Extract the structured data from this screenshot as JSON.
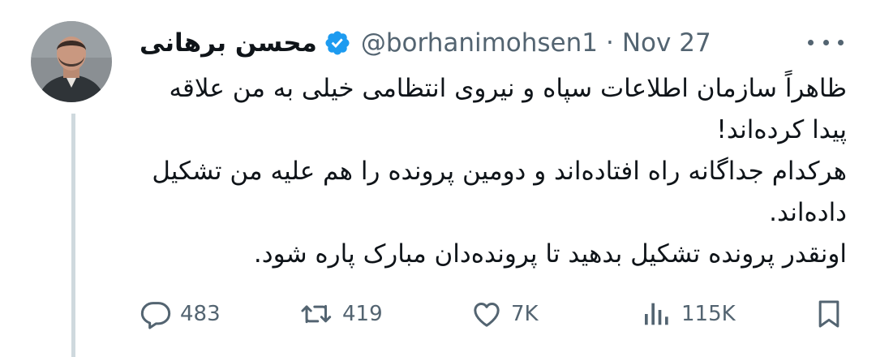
{
  "tweet": {
    "author": {
      "display_name": "محسن برهانی",
      "handle": "@borhanimohsen1",
      "verified": true,
      "avatar_icon": "avatar-photo"
    },
    "separator": "·",
    "date": "Nov 27",
    "text_lines": [
      "ظاهراً سازمان اطلاعات سپاه و نیروی انتظامی خیلی به من علاقه",
      "پیدا کرده‌اند!",
      "هرکدام جداگانه راه افتاده‌اند و دومین پرونده را هم علیه من تشکیل",
      "داده‌اند.",
      "اونقدر پرونده تشکیل بدهید تا پرونده‌دان مبارک پاره شود."
    ],
    "stats": {
      "replies": "483",
      "retweets": "419",
      "likes": "7K",
      "views": "115K"
    },
    "icons": {
      "more": "more-horizontal-icon",
      "reply": "reply-icon",
      "retweet": "retweet-icon",
      "like": "heart-icon",
      "views": "views-chart-icon",
      "bookmark": "bookmark-icon"
    }
  },
  "colors": {
    "text": "#0f1419",
    "secondary": "#536471",
    "verified": "#1d9bf0",
    "thread_line": "#cfd9de"
  }
}
